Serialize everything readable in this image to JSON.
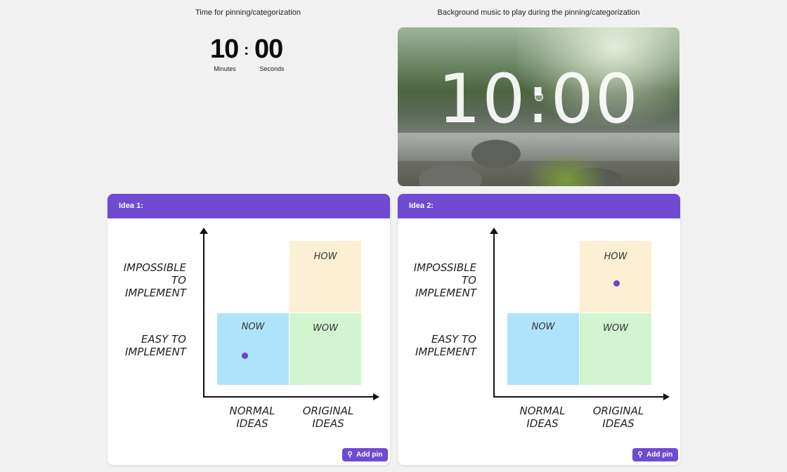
{
  "timer": {
    "caption": "Time for pinning/categorization",
    "minutes": "10",
    "colon": ":",
    "seconds": "00",
    "minutes_label": "Minutes",
    "seconds_label": "Seconds"
  },
  "music": {
    "caption": "Background music to play during the pinning/categorization",
    "video_time": "10:00"
  },
  "cards": [
    {
      "title": "Idea 1:",
      "y_high": [
        "IMPOSSIBLE TO",
        "IMPLEMENT"
      ],
      "y_low": [
        "EASY TO",
        "IMPLEMENT"
      ],
      "x_left": [
        "NORMAL",
        "IDEAS"
      ],
      "x_right": [
        "ORIGINAL",
        "IDEAS"
      ],
      "quadrants": {
        "now": "NOW",
        "wow": "WOW",
        "how": "HOW"
      },
      "pin_quadrant": "now",
      "add_pin_label": "Add pin"
    },
    {
      "title": "Idea 2:",
      "y_high": [
        "IMPOSSIBLE TO",
        "IMPLEMENT"
      ],
      "y_low": [
        "EASY TO",
        "IMPLEMENT"
      ],
      "x_left": [
        "NORMAL",
        "IDEAS"
      ],
      "x_right": [
        "ORIGINAL",
        "IDEAS"
      ],
      "quadrants": {
        "now": "NOW",
        "wow": "WOW",
        "how": "HOW"
      },
      "pin_quadrant": "how",
      "add_pin_label": "Add pin"
    }
  ],
  "colors": {
    "accent": "#6f4bd1",
    "now": "#aee3fb",
    "wow": "#d2f5cf",
    "how": "#fcefd3"
  },
  "icons": {
    "add_pin": "pin-icon"
  }
}
